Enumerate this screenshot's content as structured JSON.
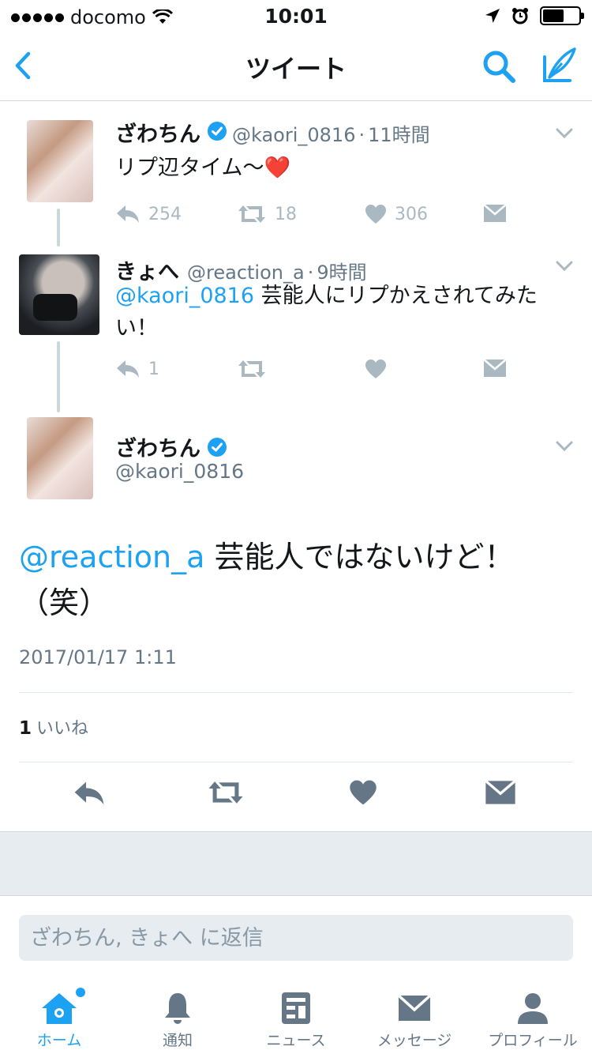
{
  "status_bar": {
    "carrier": "docomo",
    "time": "10:01"
  },
  "nav": {
    "title": "ツイート"
  },
  "thread": [
    {
      "name": "ざわちん",
      "verified": true,
      "handle": "@kaori_0816",
      "time": "11時間",
      "text": "リプ辺タイム〜❤️",
      "replies": "254",
      "retweets": "18",
      "likes": "306"
    },
    {
      "name": "きょへ",
      "verified": false,
      "handle": "@reaction_a",
      "time": "9時間",
      "mention": "@kaori_0816",
      "text": " 芸能人にリプかえされてみたい！",
      "replies": "1",
      "retweets": "",
      "likes": ""
    }
  ],
  "focused": {
    "name": "ざわちん",
    "verified": true,
    "handle": "@kaori_0816",
    "mention": "@reaction_a",
    "text": " 芸能人ではないけど！（笑）",
    "date": "2017/01/17 1:11",
    "like_count": "1",
    "like_label": "いいね"
  },
  "reply": {
    "placeholder": "ざわちん, きょへ に返信"
  },
  "tabs": [
    {
      "label": "ホーム",
      "icon": "home-icon",
      "active": true
    },
    {
      "label": "通知",
      "icon": "bell-icon",
      "active": false
    },
    {
      "label": "ニュース",
      "icon": "news-icon",
      "active": false
    },
    {
      "label": "メッセージ",
      "icon": "mail-icon",
      "active": false
    },
    {
      "label": "プロフィール",
      "icon": "person-icon",
      "active": false
    }
  ],
  "colors": {
    "accent": "#1da1f2",
    "secondary_text": "#657786",
    "icon_gray": "#aab8c2"
  }
}
